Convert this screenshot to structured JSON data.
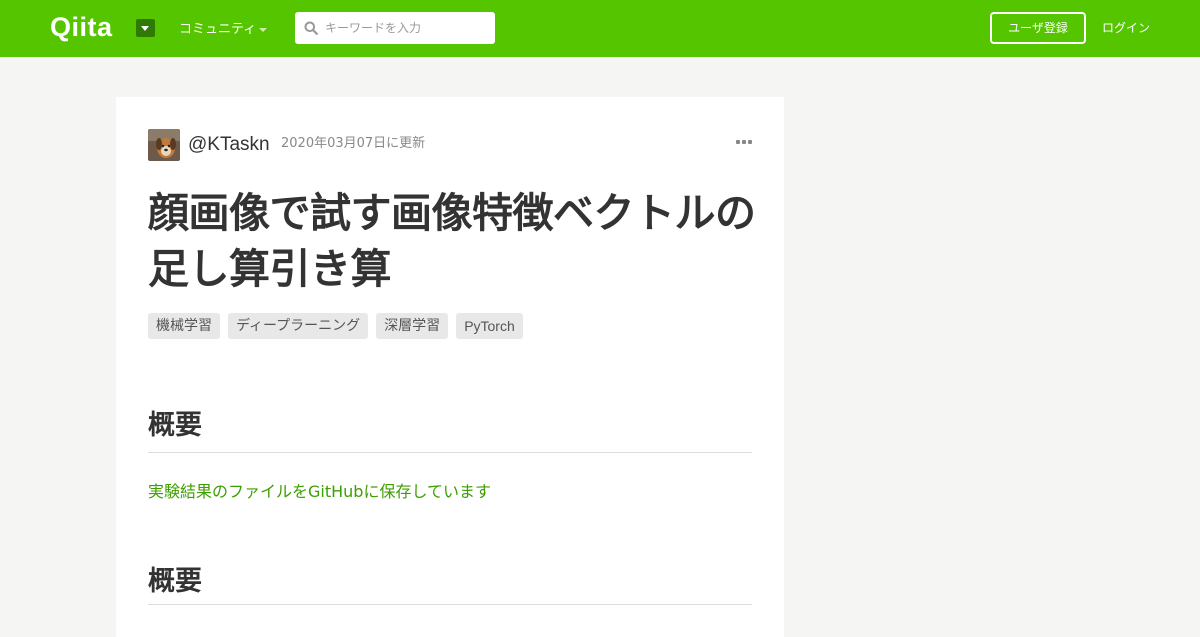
{
  "header": {
    "logo_text": "Qiita",
    "community_label": "コミュニティ",
    "search": {
      "placeholder": "キーワードを入力"
    },
    "signup_label": "ユーザ登録",
    "login_label": "ログイン"
  },
  "article": {
    "author": "@KTaskn",
    "updated": "2020年03月07日に更新",
    "title": "顔画像で試す画像特徴ベクトルの足し算引き算",
    "tags": [
      "機械学習",
      "ディープラーニング",
      "深層学習",
      "PyTorch"
    ],
    "sections": [
      {
        "heading": "概要",
        "link_text": "実験結果のファイルをGitHubに保存しています"
      },
      {
        "heading": "概要"
      }
    ]
  },
  "colors": {
    "brand": "#55c500",
    "link": "#3d9f00",
    "page_background": "#f5f5f3"
  },
  "icons": [
    "dropdown-caret-icon",
    "search-icon",
    "more-icon"
  ]
}
